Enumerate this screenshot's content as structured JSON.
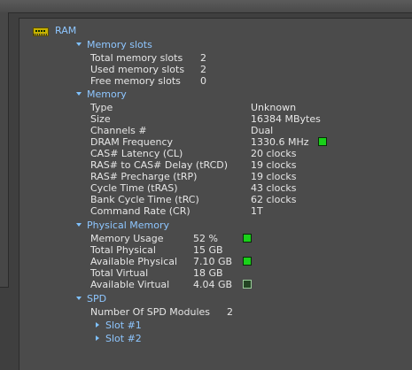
{
  "root": {
    "label": "RAM"
  },
  "memory_slots": {
    "label": "Memory slots",
    "items": [
      {
        "name": "Total memory slots",
        "value": "2"
      },
      {
        "name": "Used memory slots",
        "value": "2"
      },
      {
        "name": "Free memory slots",
        "value": "0"
      }
    ]
  },
  "memory": {
    "label": "Memory",
    "items": [
      {
        "name": "Type",
        "value": "Unknown"
      },
      {
        "name": "Size",
        "value": "16384 MBytes"
      },
      {
        "name": "Channels #",
        "value": "Dual"
      },
      {
        "name": "DRAM Frequency",
        "value": "1330.6 MHz",
        "indicator": "on"
      },
      {
        "name": "CAS# Latency (CL)",
        "value": "20 clocks"
      },
      {
        "name": "RAS# to CAS# Delay (tRCD)",
        "value": "19 clocks"
      },
      {
        "name": "RAS# Precharge (tRP)",
        "value": "19 clocks"
      },
      {
        "name": "Cycle Time (tRAS)",
        "value": "43 clocks"
      },
      {
        "name": "Bank Cycle Time (tRC)",
        "value": "62 clocks"
      },
      {
        "name": "Command Rate (CR)",
        "value": "1T"
      }
    ]
  },
  "physical_memory": {
    "label": "Physical Memory",
    "items": [
      {
        "name": "Memory Usage",
        "value": "52 %",
        "indicator": "on"
      },
      {
        "name": "Total Physical",
        "value": "15 GB"
      },
      {
        "name": "Available Physical",
        "value": "7.10 GB",
        "indicator": "on"
      },
      {
        "name": "Total Virtual",
        "value": "18 GB"
      },
      {
        "name": "Available Virtual",
        "value": "4.04 GB",
        "indicator": "off"
      }
    ]
  },
  "spd": {
    "label": "SPD",
    "modules_label": "Number Of SPD Modules",
    "modules_value": "2",
    "slots": [
      "Slot #1",
      "Slot #2"
    ]
  },
  "colors": {
    "link": "#8ec6ff",
    "indicator_on": "#19d119",
    "background": "#4b4b4b"
  },
  "icons": {
    "root": "ram-module-icon",
    "expanded": "triangle-down-icon",
    "collapsed": "triangle-right-icon"
  }
}
